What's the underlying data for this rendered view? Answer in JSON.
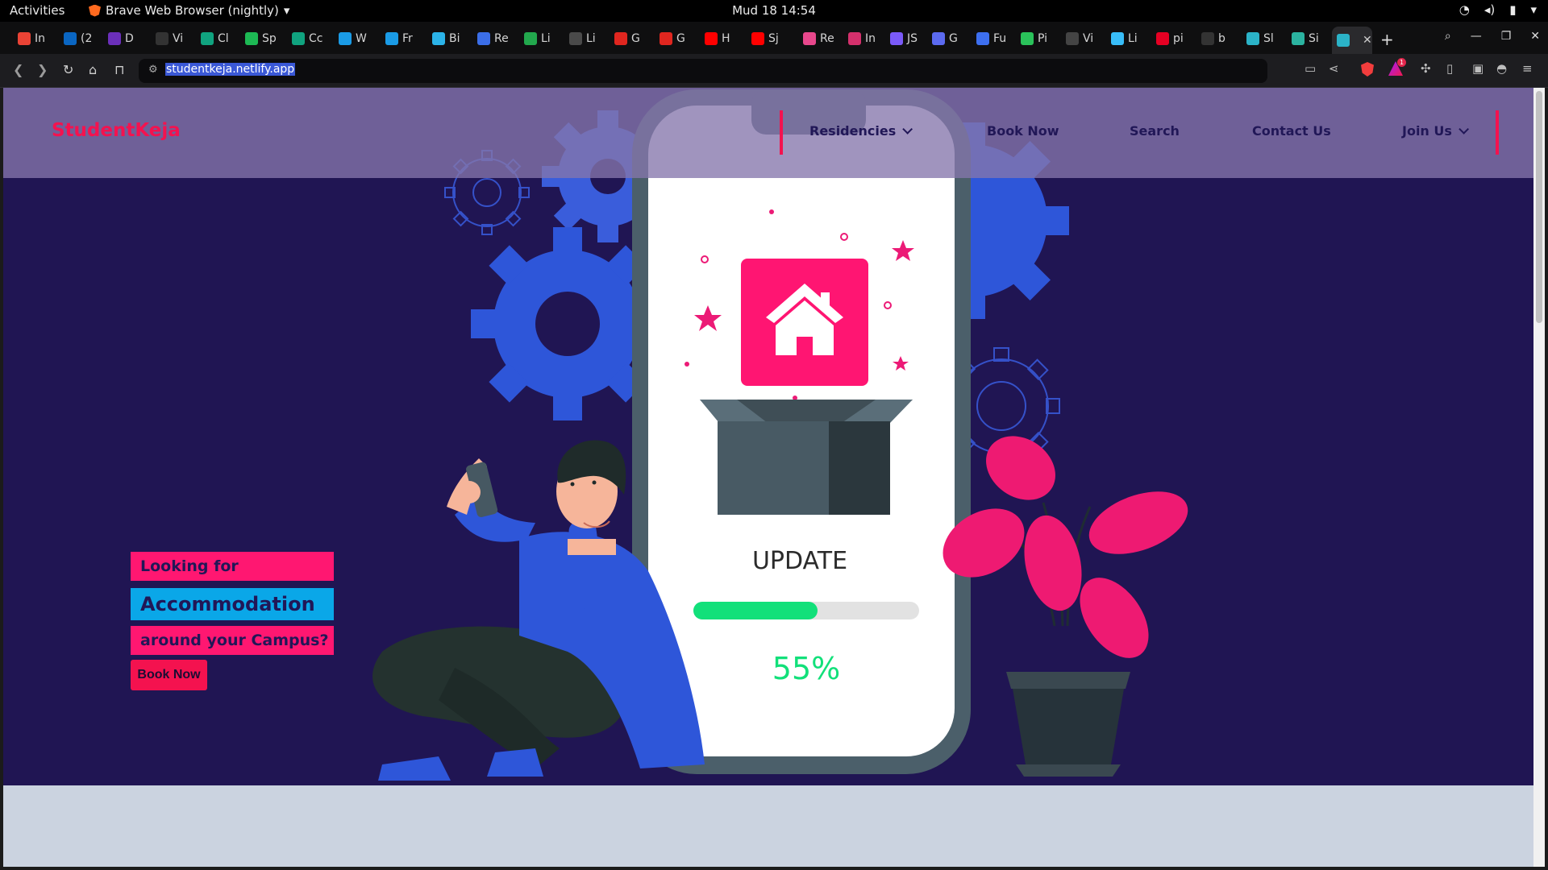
{
  "system": {
    "activities": "Activities",
    "app_name": "Brave Web Browser (nightly)",
    "clock": "Mud 18  14:54"
  },
  "browser": {
    "tabs": [
      {
        "label": "In",
        "icon": "gmail-icon",
        "color": "#ea4335"
      },
      {
        "label": "(2",
        "icon": "linkedin-icon",
        "color": "#0a66c2"
      },
      {
        "label": "D",
        "icon": "dev-icon",
        "color": "#6b2fba"
      },
      {
        "label": "Vi",
        "icon": "github-icon",
        "color": "#333333"
      },
      {
        "label": "Cl",
        "icon": "chatgpt-icon",
        "color": "#10a37f"
      },
      {
        "label": "Sp",
        "icon": "spotify-icon",
        "color": "#1db954"
      },
      {
        "label": "Cc",
        "icon": "chatgpt-icon",
        "color": "#10a37f"
      },
      {
        "label": "W",
        "icon": "play-icon",
        "color": "#1a9be6"
      },
      {
        "label": "Fr",
        "icon": "play-icon",
        "color": "#1a9be6"
      },
      {
        "label": "Bi",
        "icon": "cube-icon",
        "color": "#2bb3e8"
      },
      {
        "label": "Re",
        "icon": "flag-icon",
        "color": "#3b6ee8"
      },
      {
        "label": "Li",
        "icon": "list-icon",
        "color": "#22a84d"
      },
      {
        "label": "Li",
        "icon": "list-icon",
        "color": "#4a4a4a"
      },
      {
        "label": "G",
        "icon": "calendar-icon",
        "color": "#e0261f"
      },
      {
        "label": "G",
        "icon": "calendar-icon",
        "color": "#e0261f"
      },
      {
        "label": "H",
        "icon": "youtube-icon",
        "color": "#ff0000"
      },
      {
        "label": "Sj",
        "icon": "youtube-icon",
        "color": "#ff0000"
      },
      {
        "label": "Re",
        "icon": "pin-icon",
        "color": "#e8478c"
      },
      {
        "label": "In",
        "icon": "flower-icon",
        "color": "#d4306c"
      },
      {
        "label": "JS",
        "icon": "star-icon",
        "color": "#7a5af8"
      },
      {
        "label": "G",
        "icon": "chat-icon",
        "color": "#5b6af0"
      },
      {
        "label": "Fu",
        "icon": "grid-icon",
        "color": "#3d6ff0"
      },
      {
        "label": "Pi",
        "icon": "play-icon",
        "color": "#2ac25a"
      },
      {
        "label": "Vi",
        "icon": "s-icon",
        "color": "#444444"
      },
      {
        "label": "Li",
        "icon": "tailwind-icon",
        "color": "#38bdf8"
      },
      {
        "label": "pi",
        "icon": "pinterest-icon",
        "color": "#e60023"
      },
      {
        "label": "b",
        "icon": "medium-icon",
        "color": "#333333"
      },
      {
        "label": "Sl",
        "icon": "react-icon",
        "color": "#2bb3c8"
      },
      {
        "label": "Si",
        "icon": "diamond-icon",
        "color": "#2bb3a0"
      },
      {
        "label": "",
        "icon": "react-icon",
        "color": "#2bb3c8"
      }
    ],
    "url": "studentkeja.netlify.app"
  },
  "site": {
    "logo": "StudentKeja",
    "nav": {
      "residencies": "Residencies",
      "book_now": "Book Now",
      "search": "Search",
      "contact": "Contact Us",
      "join": "Join Us"
    },
    "hero": {
      "line1": "Looking for",
      "line2": "Accommodation",
      "line3": "around your Campus?",
      "cta": "Book Now"
    },
    "illustration": {
      "update_label": "UPDATE",
      "progress_text": "55%",
      "progress_fraction": 0.55
    }
  },
  "colors": {
    "hero_bg": "#201553",
    "accent_pink": "#ff1771",
    "accent_blue": "#0aa7e8",
    "brand_red": "#f4124f",
    "progress_green": "#12e07a",
    "gear_blue": "#2e56d9"
  }
}
